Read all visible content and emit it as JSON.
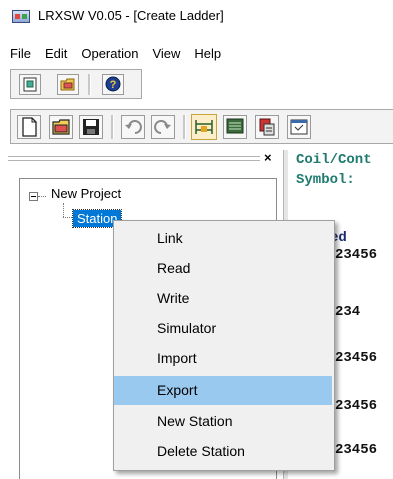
{
  "window": {
    "title": "LRXSW V0.05 - [Create Ladder]"
  },
  "menubar": {
    "items": [
      "File",
      "Edit",
      "Operation",
      "View",
      "Help"
    ]
  },
  "toolbar1": {
    "buttons": [
      "new-project-icon",
      "open-project-icon",
      "help-icon"
    ]
  },
  "toolbar2": {
    "buttons": [
      "new-file-icon",
      "open-folder-icon",
      "save-icon",
      "undo-icon",
      "redo-icon",
      "ladder-view-icon",
      "monitor-icon",
      "compile-icon",
      "window-icon"
    ]
  },
  "left_pane": {
    "close_symbol": "×",
    "tree": {
      "root": "New Project",
      "child": "Station"
    }
  },
  "right_pane": {
    "header_line1": "Coil/Cont",
    "header_line2": "Symbol:",
    "lines": [
      "ed",
      "23456",
      "234",
      "23456",
      "23456",
      "23456"
    ]
  },
  "context_menu": {
    "items": [
      "Link",
      "Read",
      "Write",
      "Simulator",
      "Import",
      "Export",
      "New Station",
      "Delete Station"
    ],
    "highlighted_index": 5,
    "highlight_color": "#99c9ef"
  },
  "colors": {
    "selection": "#0078d7",
    "teal_text": "#1f7a6f",
    "navy_text": "#1b2a6b"
  }
}
